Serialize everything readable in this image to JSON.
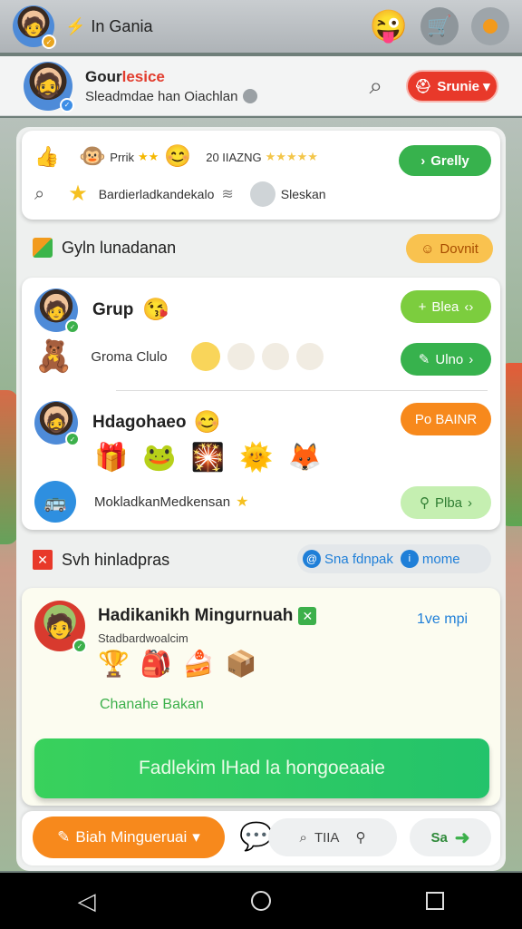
{
  "status_bar": {
    "title": "In Gania",
    "title_icon": "lightning-icon"
  },
  "header": {
    "name_prefix": "Gour",
    "name_red": "lesice",
    "subtitle": "Sleadmdae han Oiachlan",
    "action_label": "Srunie ▾"
  },
  "top_card": {
    "label_a": "Prrik",
    "label_b": "20 IIAZNG",
    "action_label": "Grelly",
    "search_text": "Bardierladkandekalo",
    "chip_label": "Sleskan"
  },
  "section1": {
    "title": "Gyln lunadanan",
    "action_label": "Dovnit"
  },
  "group_card": {
    "row1_title": "Grup",
    "row1_action": "Blea",
    "row2_label": "Groma Clulo",
    "row2_action": "Ulno",
    "row3_title": "Hdagohaeo",
    "row3_action": "Po BAINR",
    "row4_label": "MokladkanMedkensan",
    "row4_action": "Plba"
  },
  "section2": {
    "title": "Svh hinladpras",
    "chip1": "Sna fdnpak",
    "chip2": "mome"
  },
  "feature_card": {
    "title": "Hadikanikh Mingurnuah",
    "tag": "1ve mpi",
    "subtitle": "Stadbardwoalcim",
    "link_text": "Chanahe Bakan",
    "cta": "Fadlekim lHad la hongoeaaie"
  },
  "bottom_bar": {
    "primary_label": "Biah Mingueruai",
    "tag_label": "TIIA",
    "next_label": "Sa"
  },
  "colors": {
    "accent_green": "#37b24d",
    "accent_red": "#e8392a",
    "accent_orange": "#f7891c",
    "link_blue": "#1f7fd8"
  }
}
